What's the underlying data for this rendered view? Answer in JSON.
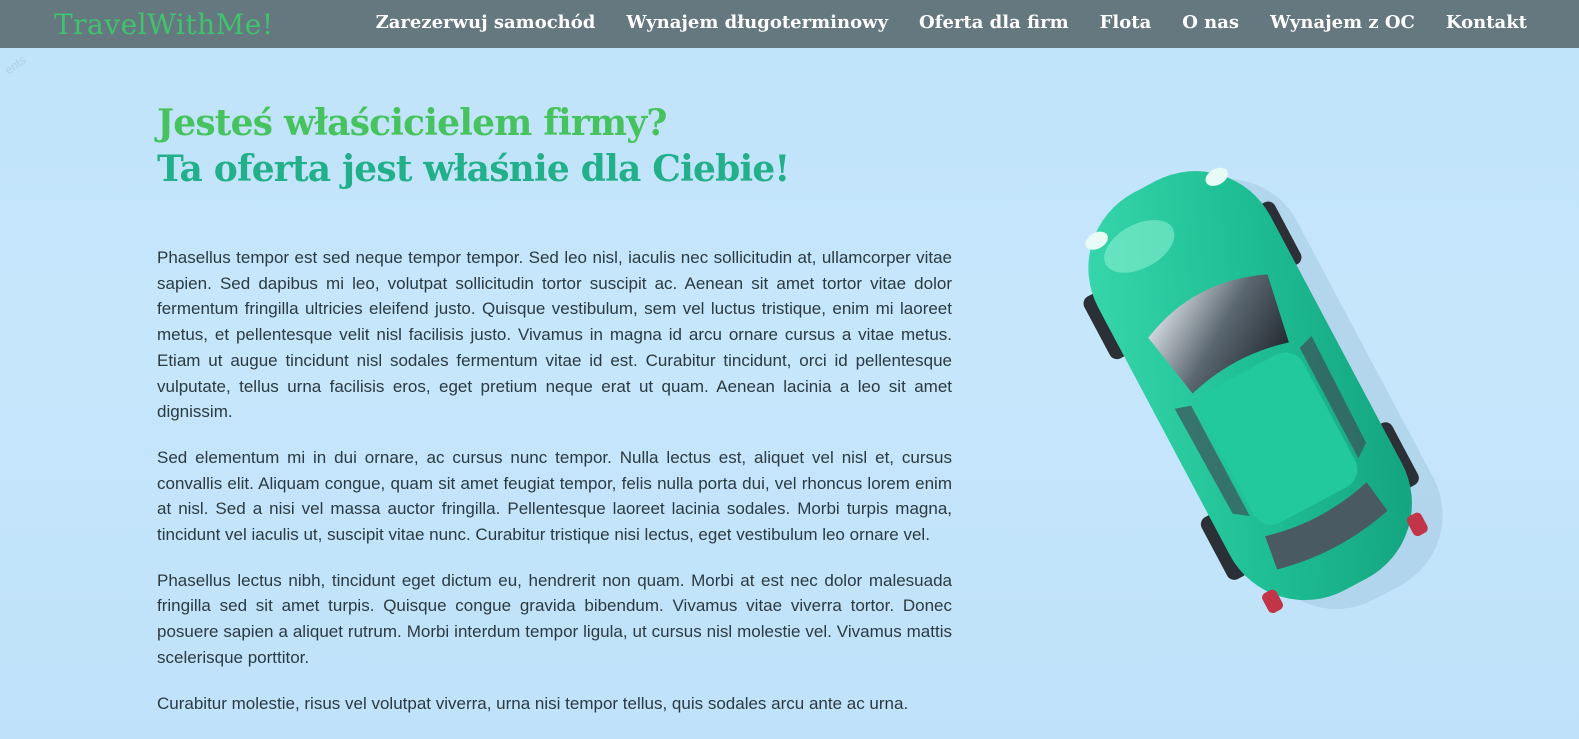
{
  "header": {
    "logo": "TravelWithMe!",
    "nav": [
      "Zarezerwuj samochód",
      "Wynajem długoterminowy",
      "Oferta dla firm",
      "Flota",
      "O nas",
      "Wynajem z OC",
      "Kontakt"
    ]
  },
  "hero": {
    "title_line1": "Jesteś właścicielem firmy?",
    "title_line2": "Ta oferta jest właśnie dla Ciebie!"
  },
  "content": {
    "paragraphs": [
      "Phasellus tempor est sed neque tempor tempor. Sed leo nisl, iaculis nec sollicitudin at, ullamcorper vitae sapien. Sed dapibus mi leo, volutpat sollicitudin tortor suscipit ac. Aenean sit amet tortor vitae dolor fermentum fringilla ultricies eleifend justo. Quisque vestibulum, sem vel luctus tristique, enim mi laoreet metus, et pellentesque velit nisl facilisis justo. Vivamus in magna id arcu ornare cursus a vitae metus. Etiam ut augue tincidunt nisl sodales fermentum vitae id est. Curabitur tincidunt, orci id pellentesque vulputate, tellus urna facilisis eros, eget pretium neque erat ut quam. Aenean lacinia a leo sit amet dignissim.",
      "Sed elementum mi in dui ornare, ac cursus nunc tempor. Nulla lectus est, aliquet vel nisl et, cursus convallis elit. Aliquam congue, quam sit amet feugiat tempor, felis nulla porta dui, vel rhoncus lorem enim at nisl. Sed a nisi vel massa auctor fringilla. Pellentesque laoreet lacinia sodales. Morbi turpis magna, tincidunt vel iaculis ut, suscipit vitae nunc. Curabitur tristique nisi lectus, eget vestibulum leo ornare vel.",
      "Phasellus lectus nibh, tincidunt eget dictum eu, hendrerit non quam. Morbi at est nec dolor malesuada fringilla sed sit amet turpis. Quisque congue gravida bibendum. Vivamus vitae viverra tortor. Donec posuere sapien a aliquet rutrum. Morbi interdum tempor ligula, ut cursus nisl molestie vel. Vivamus mattis scelerisque porttitor.",
      "Curabitur molestie, risus vel volutpat viverra, urna nisi tempor tellus, quis sodales arcu ante ac urna."
    ]
  },
  "background": {
    "watermark": "ents"
  },
  "colors": {
    "nav_bg": "#66787f",
    "logo": "#3ec46d",
    "title_line1": "#46c35f",
    "title_line2": "#22b08a",
    "page_bg": "#c2e4fa",
    "car_body": "#1fbf95"
  },
  "image": {
    "icon": "toy-car-image"
  }
}
